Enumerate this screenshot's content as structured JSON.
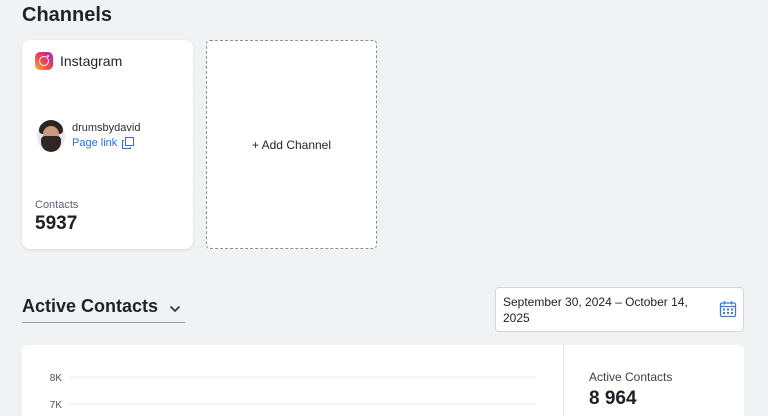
{
  "channels": {
    "heading": "Channels",
    "add_channel_label": "+ Add Channel",
    "items": [
      {
        "platform": "Instagram",
        "icon": "instagram-icon",
        "username": "drumsbydavid",
        "page_link_label": "Page link",
        "contacts_label": "Contacts",
        "contacts_value": "5937"
      }
    ]
  },
  "active_contacts": {
    "title": "Active Contacts",
    "date_range": "September 30, 2024 – October 14, 2025",
    "metric_label": "Active Contacts",
    "metric_value": "8 964"
  },
  "chart_data": {
    "type": "line",
    "title": "",
    "xlabel": "",
    "ylabel": "",
    "y_ticks": [
      "8K",
      "7K"
    ],
    "ylim": [
      7000,
      8000
    ],
    "grid": true,
    "series": []
  },
  "colors": {
    "link": "#2f6fd6",
    "accent": "#3b7ddd",
    "background": "#f1f2f4"
  }
}
